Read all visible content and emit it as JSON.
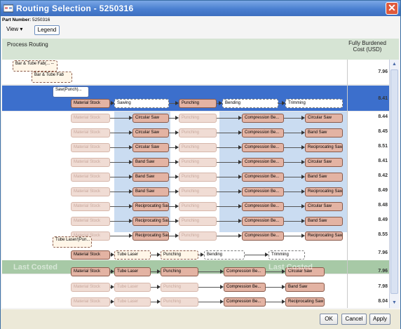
{
  "window": {
    "title": "Routing Selection - 5250316",
    "close_glyph": "✕"
  },
  "part": {
    "label": "Part Number:",
    "value": "5250316"
  },
  "toolbar": {
    "view_label": "View ▾",
    "legend_label": "Legend"
  },
  "header": {
    "left": "Process Routing",
    "right": "Fully Burdened Cost (USD)"
  },
  "tree": {
    "root": "Bar & Tube Fab(...",
    "root_sub": "--",
    "child": "Bar & Tube Fab",
    "child_sub": "--",
    "saw": "Saw(Punch)...",
    "saw_sub": "--",
    "laser": "Tube Laser/(Pun...",
    "laser_sub": "--"
  },
  "steps": {
    "material": "Material Stock",
    "sawing": "Sawing",
    "punching": "Punching",
    "bending": "Bending",
    "trimming": "Trimming",
    "tube_laser": "Tube Laser",
    "dash": "--"
  },
  "rows": [
    {
      "cost": "7.96"
    },
    {
      "cost": "8.41"
    },
    {
      "saw": "Circular Saw",
      "bend": "Compression Be...",
      "trim": "Circular Saw",
      "cost": "8.44"
    },
    {
      "saw": "Circular Saw",
      "bend": "Compression Be...",
      "trim": "Band Saw",
      "cost": "8.45"
    },
    {
      "saw": "Circular Saw",
      "bend": "Compression Be...",
      "trim": "Reciprocating Saw",
      "cost": "8.51"
    },
    {
      "saw": "Band Saw",
      "bend": "Compression Be...",
      "trim": "Circular Saw",
      "cost": "8.41"
    },
    {
      "saw": "Band Saw",
      "bend": "Compression Be...",
      "trim": "Band Saw",
      "cost": "8.42"
    },
    {
      "saw": "Band Saw",
      "bend": "Compression Be...",
      "trim": "Reciprocating Saw",
      "cost": "8.49"
    },
    {
      "saw": "Reciprocating Saw",
      "bend": "Compression Be...",
      "trim": "Circular Saw",
      "cost": "8.48"
    },
    {
      "saw": "Reciprocating Saw",
      "bend": "Compression Be...",
      "trim": "Band Saw",
      "cost": "8.49"
    },
    {
      "saw": "Reciprocating Saw",
      "bend": "Compression Be...",
      "trim": "Reciprocating Saw",
      "cost": "8.55"
    },
    {
      "cost": "7.96"
    },
    {
      "bend": "Compression Be...",
      "trim": "Circular Saw",
      "cost": "7.96"
    },
    {
      "bend": "Compression Be...",
      "trim": "Band Saw",
      "cost": "7.98"
    },
    {
      "bend": "Compression Be...",
      "trim": "Reciprocating Saw",
      "cost": "8.04"
    }
  ],
  "last_costed": "Last Costed",
  "footer": {
    "ok": "OK",
    "cancel": "Cancel",
    "apply": "Apply"
  },
  "colors": {
    "title_bar": "#4a7fd0",
    "selected_row": "#3c6fcc",
    "last_costed_row": "#a7c9a6",
    "node": "#e3b3a3"
  }
}
